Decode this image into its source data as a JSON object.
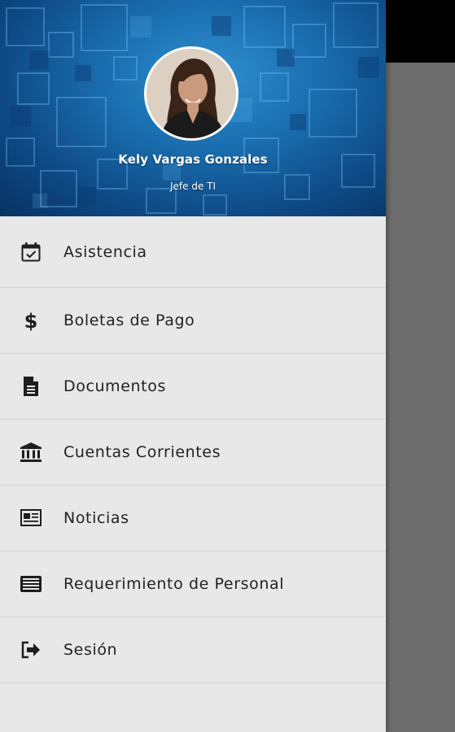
{
  "profile": {
    "name": "Kely Vargas Gonzales",
    "role": "Jefe de TI"
  },
  "colors": {
    "header_accent": "#1a6fb0",
    "drawer_bg": "#e8e8e8",
    "scrim": "#6d6d6d"
  },
  "menu": {
    "items": [
      {
        "label": "Asistencia",
        "icon": "calendar-check-icon"
      },
      {
        "label": "Boletas de Pago",
        "icon": "dollar-icon"
      },
      {
        "label": "Documentos",
        "icon": "document-icon"
      },
      {
        "label": "Cuentas Corrientes",
        "icon": "bank-icon"
      },
      {
        "label": "Noticias",
        "icon": "newspaper-icon"
      },
      {
        "label": "Requerimiento de Personal",
        "icon": "list-card-icon"
      },
      {
        "label": "Sesión",
        "icon": "sign-out-icon"
      }
    ]
  }
}
